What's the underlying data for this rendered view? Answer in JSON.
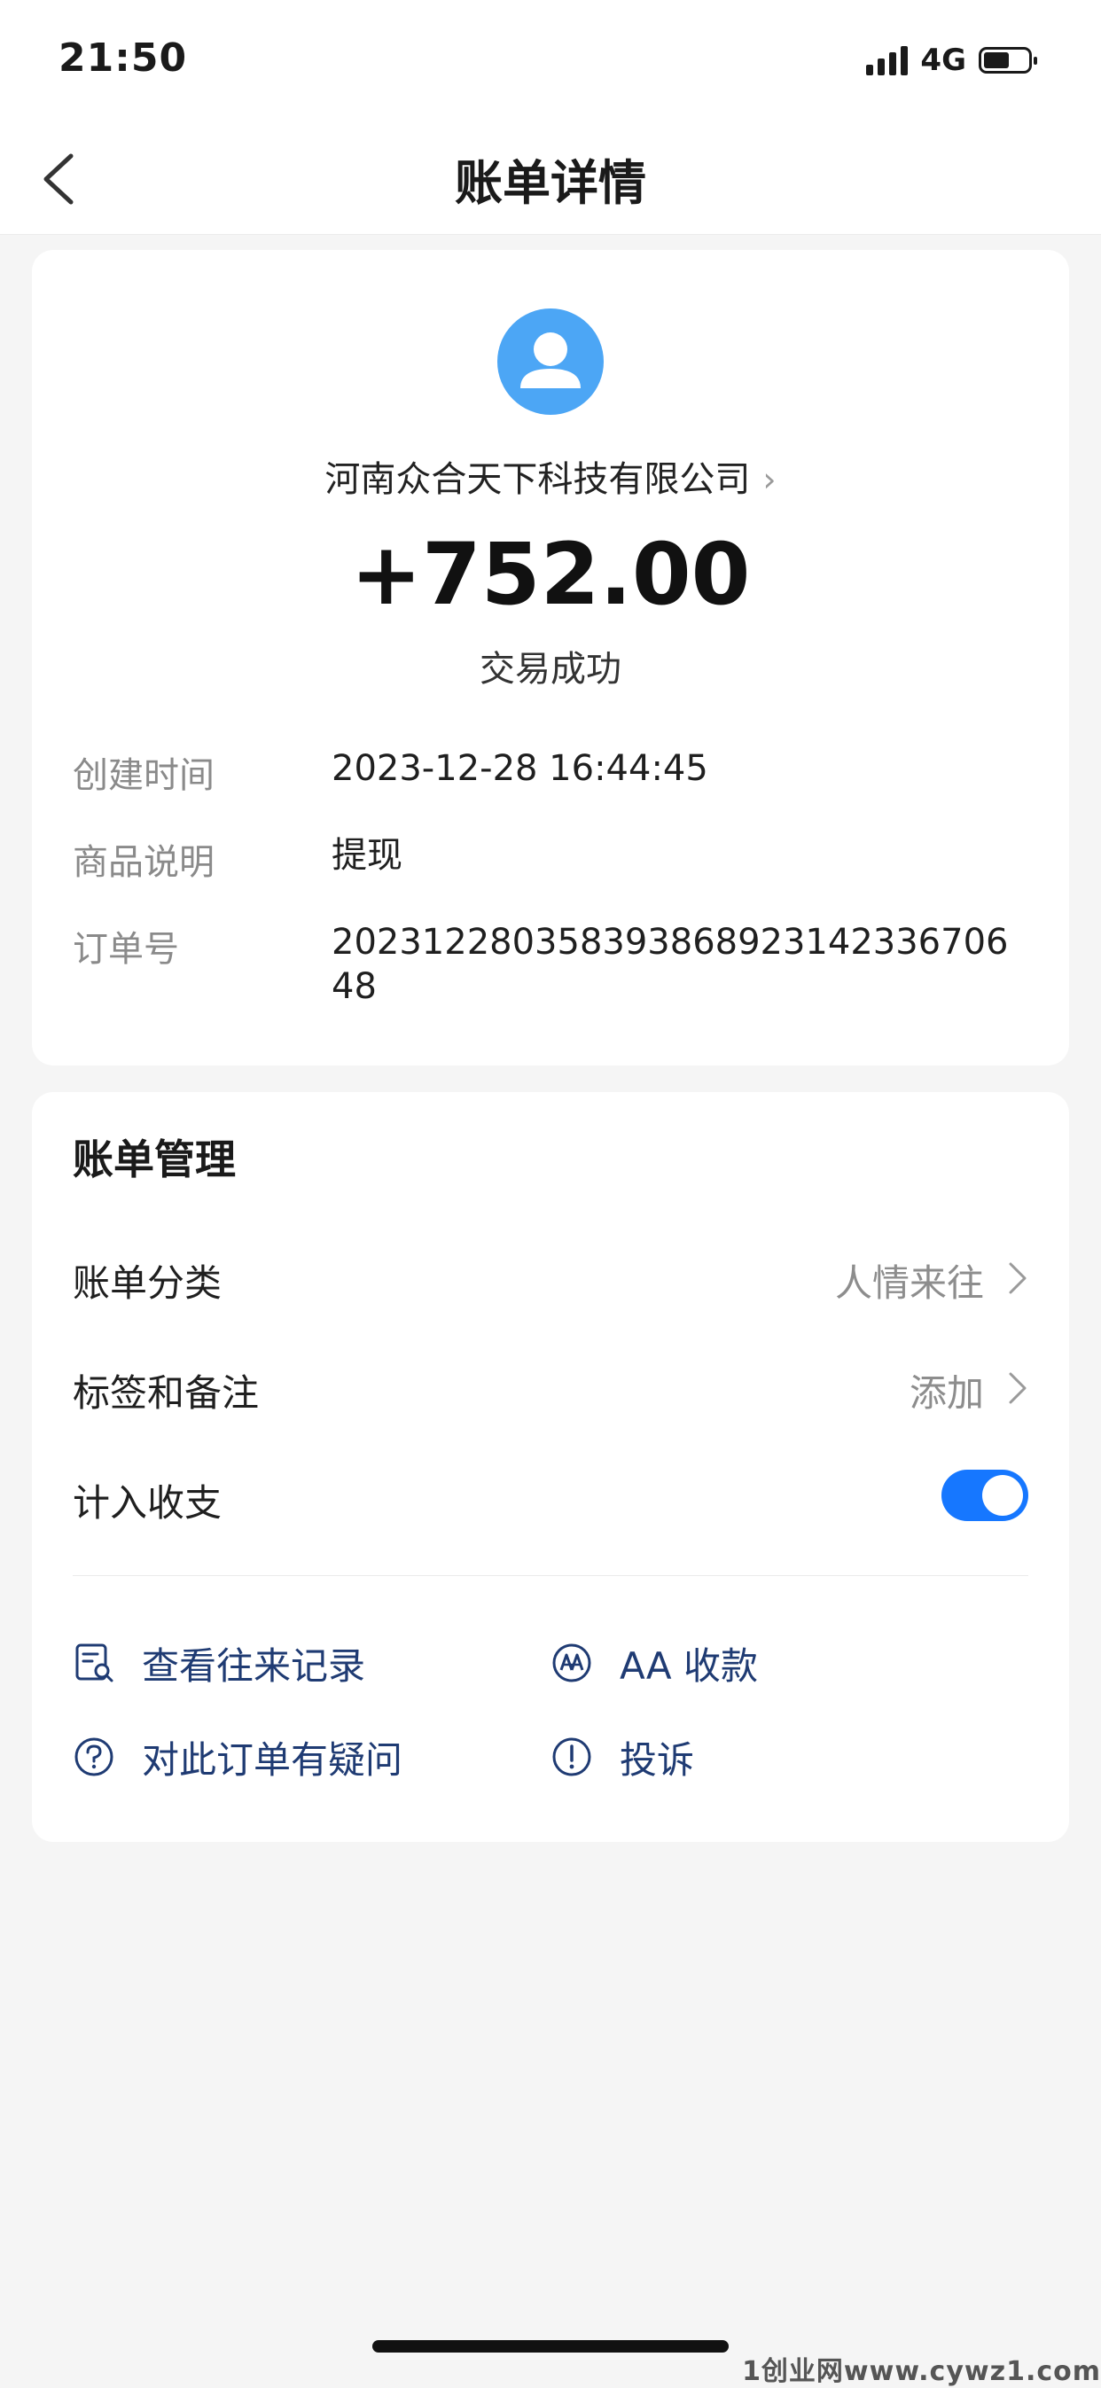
{
  "status_bar": {
    "time": "21:50",
    "network": "4G"
  },
  "nav": {
    "title": "账单详情"
  },
  "summary": {
    "merchant": "河南众合天下科技有限公司",
    "amount": "+752.00",
    "status": "交易成功"
  },
  "details": [
    {
      "label": "创建时间",
      "value": "2023-12-28 16:44:45"
    },
    {
      "label": "商品说明",
      "value": "提现"
    },
    {
      "label": "订单号",
      "value": "20231228035839386892314233670648"
    }
  ],
  "management": {
    "title": "账单管理",
    "category": {
      "label": "账单分类",
      "value": "人情来往"
    },
    "tags": {
      "label": "标签和备注",
      "value": "添加"
    },
    "include": {
      "label": "计入收支",
      "enabled": true
    }
  },
  "actions": {
    "records": "查看往来记录",
    "aa": "AA 收款",
    "question": "对此订单有疑问",
    "complaint": "投诉"
  },
  "colors": {
    "accent": "#1677ff",
    "avatar": "#4ca6f5",
    "action_text": "#1f3b73"
  },
  "watermark": "1创业网www.cywz1.com"
}
